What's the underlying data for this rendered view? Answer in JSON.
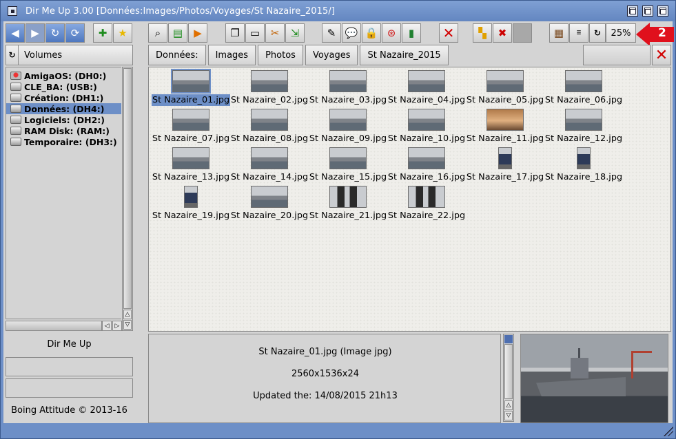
{
  "window": {
    "title": "Dir Me Up 3.00 [Données:Images/Photos/Voyages/St Nazaire_2015/]"
  },
  "toolbar": {
    "zoom": "25%",
    "callout_number": "2",
    "icons": [
      "back-arrow-icon",
      "forward-arrow-icon",
      "reload-icon",
      "sync-icon",
      "add-icon",
      "favorite-star-icon",
      "search-icon",
      "film-icon",
      "play-icon",
      "copy-icon",
      "paste-icon",
      "cut-icon",
      "move-icon",
      "edit-icon",
      "comment-icon",
      "lock-icon",
      "help-icon",
      "book-icon",
      "delete-icon",
      "open-with-icon",
      "mute-icon",
      "blank-icon",
      "view-thumbs-icon",
      "view-list-icon",
      "refresh-zoom-icon"
    ]
  },
  "volumes": {
    "header": "Volumes",
    "items": [
      {
        "label": "AmigaOS: (DH0:)",
        "icon": "amiga-drive-icon",
        "selected": false
      },
      {
        "label": "CLE_BA: (USB:)",
        "icon": "usb-drive-icon",
        "selected": false
      },
      {
        "label": "Création: (DH1:)",
        "icon": "hard-drive-icon",
        "selected": false
      },
      {
        "label": "Données: (DH4:)",
        "icon": "hard-drive-icon",
        "selected": true
      },
      {
        "label": "Logiciels: (DH2:)",
        "icon": "hard-drive-icon",
        "selected": false
      },
      {
        "label": "RAM Disk: (RAM:)",
        "icon": "ram-disk-icon",
        "selected": false
      },
      {
        "label": "Temporaire: (DH3:)",
        "icon": "hard-drive-icon",
        "selected": false
      }
    ]
  },
  "sidebar": {
    "app_name": "Dir Me Up",
    "copyright": "Boing Attitude © 2013-16"
  },
  "breadcrumbs": [
    "Données:",
    "Images",
    "Photos",
    "Voyages",
    "St Nazaire_2015"
  ],
  "files": [
    {
      "name": "St Nazaire_01.jpg",
      "kind": "ship",
      "selected": true
    },
    {
      "name": "St Nazaire_02.jpg",
      "kind": "ship",
      "selected": false
    },
    {
      "name": "St Nazaire_03.jpg",
      "kind": "ship",
      "selected": false
    },
    {
      "name": "St Nazaire_04.jpg",
      "kind": "ship",
      "selected": false
    },
    {
      "name": "St Nazaire_05.jpg",
      "kind": "ship",
      "selected": false
    },
    {
      "name": "St Nazaire_06.jpg",
      "kind": "ship",
      "selected": false
    },
    {
      "name": "St Nazaire_07.jpg",
      "kind": "ship",
      "selected": false
    },
    {
      "name": "St Nazaire_08.jpg",
      "kind": "ship",
      "selected": false
    },
    {
      "name": "St Nazaire_09.jpg",
      "kind": "ship",
      "selected": false
    },
    {
      "name": "St Nazaire_10.jpg",
      "kind": "ship",
      "selected": false
    },
    {
      "name": "St Nazaire_11.jpg",
      "kind": "face",
      "selected": false
    },
    {
      "name": "St Nazaire_12.jpg",
      "kind": "ship",
      "selected": false
    },
    {
      "name": "St Nazaire_13.jpg",
      "kind": "ship",
      "selected": false
    },
    {
      "name": "St Nazaire_14.jpg",
      "kind": "ship",
      "selected": false
    },
    {
      "name": "St Nazaire_15.jpg",
      "kind": "ship",
      "selected": false
    },
    {
      "name": "St Nazaire_16.jpg",
      "kind": "ship",
      "selected": false
    },
    {
      "name": "St Nazaire_17.jpg",
      "kind": "narrow",
      "selected": false
    },
    {
      "name": "St Nazaire_18.jpg",
      "kind": "narrow",
      "selected": false
    },
    {
      "name": "St Nazaire_19.jpg",
      "kind": "narrow",
      "selected": false
    },
    {
      "name": "St Nazaire_20.jpg",
      "kind": "ship",
      "selected": false
    },
    {
      "name": "St Nazaire_21.jpg",
      "kind": "people",
      "selected": false
    },
    {
      "name": "St Nazaire_22.jpg",
      "kind": "people",
      "selected": false
    }
  ],
  "info": {
    "filename": "St Nazaire_01.jpg (Image jpg)",
    "dimensions": "2560x1536x24",
    "updated": "Updated the: 14/08/2015 21h13"
  },
  "colors": {
    "accent": "#6d8fc7",
    "panel": "#d4d4d4",
    "callout": "#e0101c",
    "delete": "#d10000"
  }
}
